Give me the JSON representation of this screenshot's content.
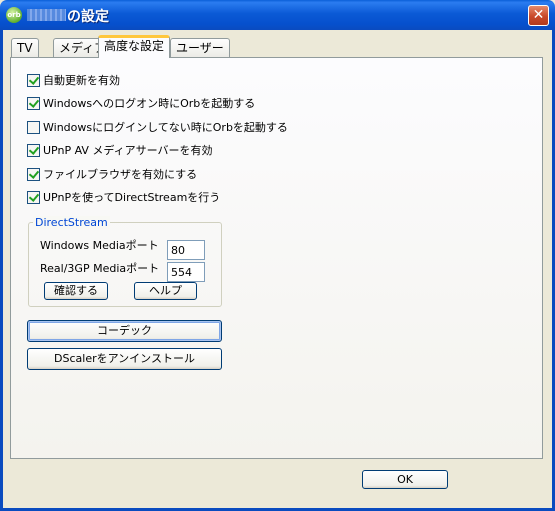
{
  "window": {
    "title_suffix": "の設定",
    "logo_text": "orb",
    "close_glyph": "✕"
  },
  "tabs": [
    {
      "label": "TV"
    },
    {
      "label": "メディア"
    },
    {
      "label": "高度な設定",
      "active": true
    },
    {
      "label": "ユーザー"
    }
  ],
  "options": [
    {
      "label": "自動更新を有効",
      "checked": true
    },
    {
      "label": "Windowsへのログオン時にOrbを起動する",
      "checked": true
    },
    {
      "label": "Windowsにログインしてない時にOrbを起動する",
      "checked": false
    },
    {
      "label": "UPnP AV メディアサーバーを有効",
      "checked": true
    },
    {
      "label": "ファイルブラウザを有効にする",
      "checked": true
    },
    {
      "label": "UPnPを使ってDirectStreamを行う",
      "checked": true
    }
  ],
  "direct_stream": {
    "title": "DirectStream",
    "wm_port_label": "Windows Mediaポート",
    "wm_port_value": "80",
    "real_port_label": "Real/3GP Mediaポート",
    "real_port_value": "554",
    "confirm_label": "確認する",
    "help_label": "ヘルプ"
  },
  "codec_button": "コーデック",
  "dscaler_button": "DScalerをアンインストール",
  "ok_button": "OK",
  "colors": {
    "titlebar": "#0a5fd8",
    "group_title": "#0046d5",
    "active_tab_accent": "#ffc73c"
  }
}
